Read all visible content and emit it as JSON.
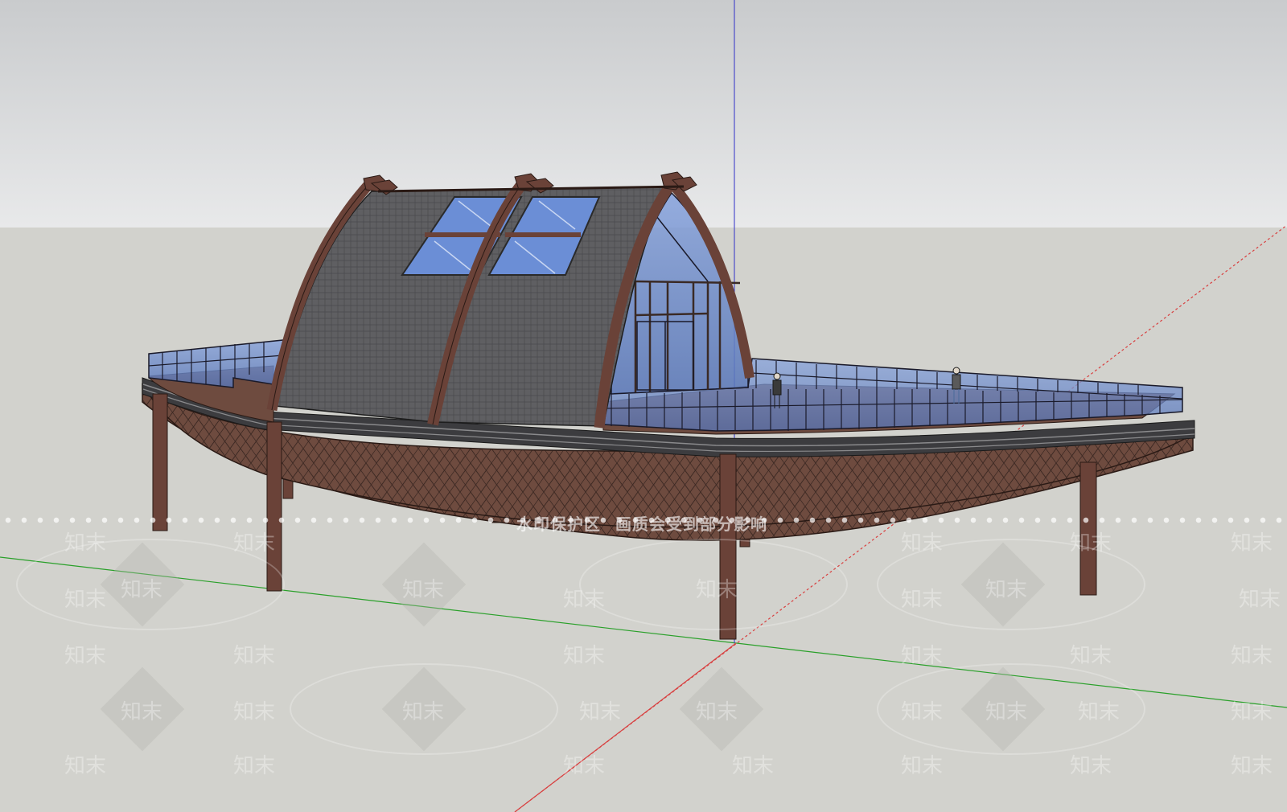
{
  "scene": {
    "sky_top_color": "#c9cbcd",
    "sky_bottom_color": "#e6e7e8",
    "ground_color": "#d2d2cd",
    "axis_colors": {
      "red": "#d84040",
      "green": "#2aa02a",
      "blue": "#3030c8"
    },
    "hull_color": "#6e4b3f",
    "timber_color": "#6a4238",
    "roof_color": "#5f5f62",
    "glass_color": "#6f8fd0"
  },
  "watermark": {
    "notice_part1": "水印保护区",
    "notice_part2": "画质会受到部分影响",
    "tile_text": "知末"
  }
}
